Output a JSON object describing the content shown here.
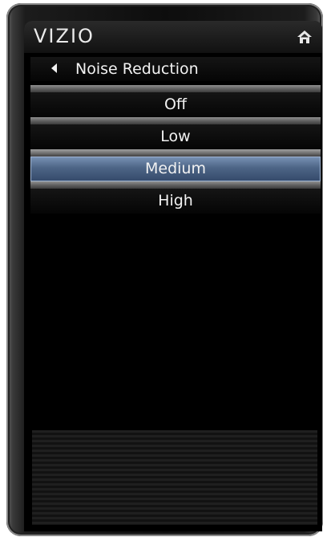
{
  "brand": {
    "logo_text": "VIZIO"
  },
  "nav": {
    "home_icon": "home-icon",
    "back_icon": "back-arrow-icon"
  },
  "menu": {
    "title": "Noise Reduction",
    "selected_option": "Medium",
    "options": [
      {
        "label": "Off"
      },
      {
        "label": "Low"
      },
      {
        "label": "Medium"
      },
      {
        "label": "High"
      }
    ]
  },
  "colors": {
    "selection_highlight": "#4d6586",
    "background": "#000000",
    "text": "#f2f2f2"
  }
}
